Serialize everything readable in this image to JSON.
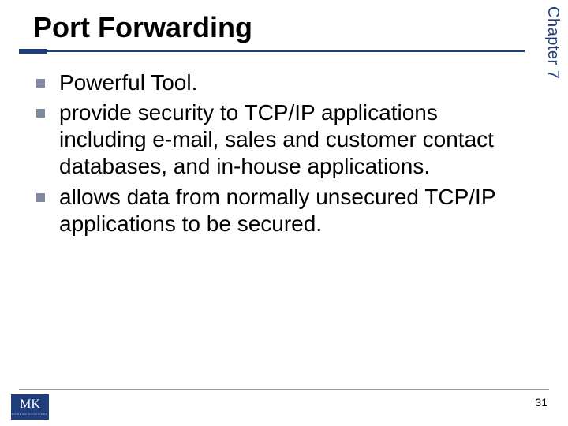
{
  "chapter_label": "Chapter 7",
  "title": "Port Forwarding",
  "bullets": {
    "b0": "Powerful Tool.",
    "b1": "provide security to TCP/IP applications including e-mail, sales and customer contact databases, and in-house applications.",
    "b2": "allows data from normally unsecured TCP/IP applications to be secured."
  },
  "logo": {
    "main": "MK",
    "sub": "MORGAN KAUFMANN"
  },
  "page_number": "31"
}
